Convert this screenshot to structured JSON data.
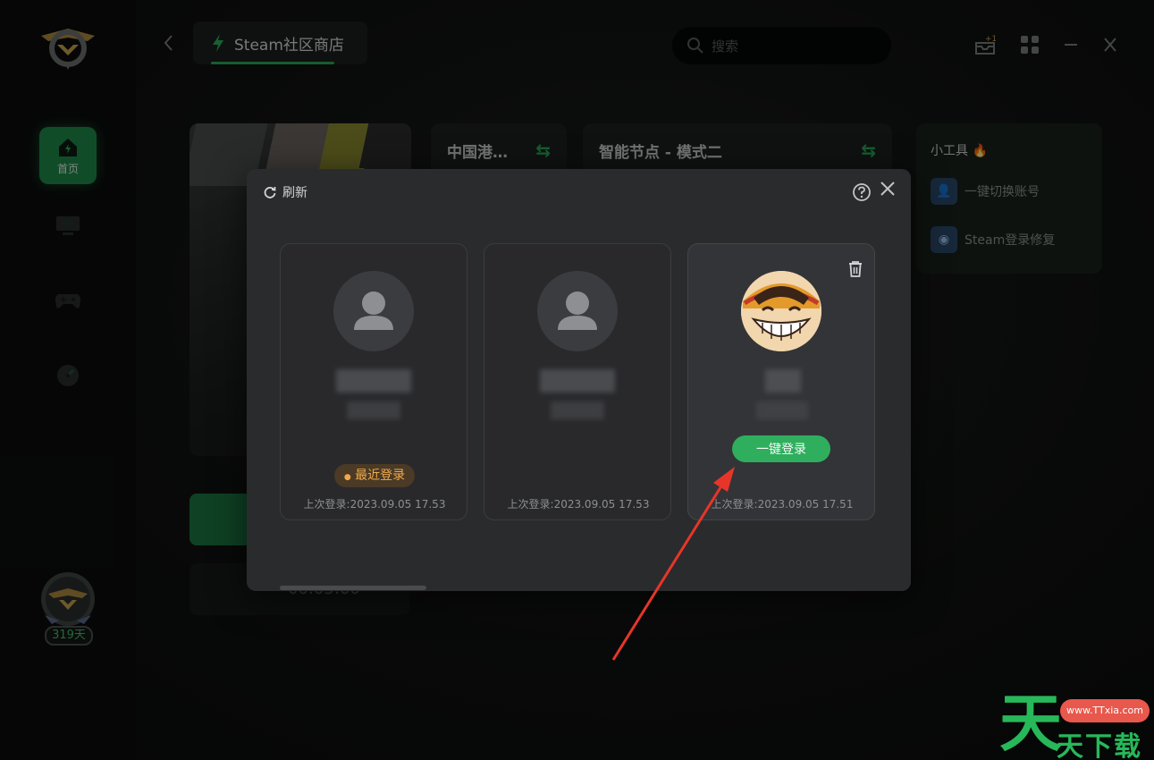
{
  "sidebar": {
    "home_label": "首页",
    "days_label": "319天"
  },
  "topbar": {
    "store_tab_label": "Steam社区商店",
    "search_placeholder": "搜索"
  },
  "background": {
    "region_node": "中国港…",
    "smart_node": "智能节点 - 模式二",
    "timer": "00:05:00",
    "tools": {
      "title": "小工具",
      "items": [
        {
          "label": "一键切换账号"
        },
        {
          "label": "Steam登录修复"
        }
      ]
    }
  },
  "modal": {
    "refresh_label": "刷新",
    "accounts": [
      {
        "recent_badge": "最近登录",
        "last_login": "上次登录:2023.09.05 17.53"
      },
      {
        "last_login": "上次登录:2023.09.05 17.53"
      },
      {
        "login_button": "一键登录",
        "last_login": "上次登录:2023.09.05 17.51"
      }
    ]
  },
  "watermark": {
    "big": "天",
    "pill": "www.TTxia.com",
    "small": "天下载"
  },
  "colors": {
    "accent_green": "#2fae5e",
    "recent_orange": "#f0a94a",
    "annotation_red": "#e8352a"
  }
}
